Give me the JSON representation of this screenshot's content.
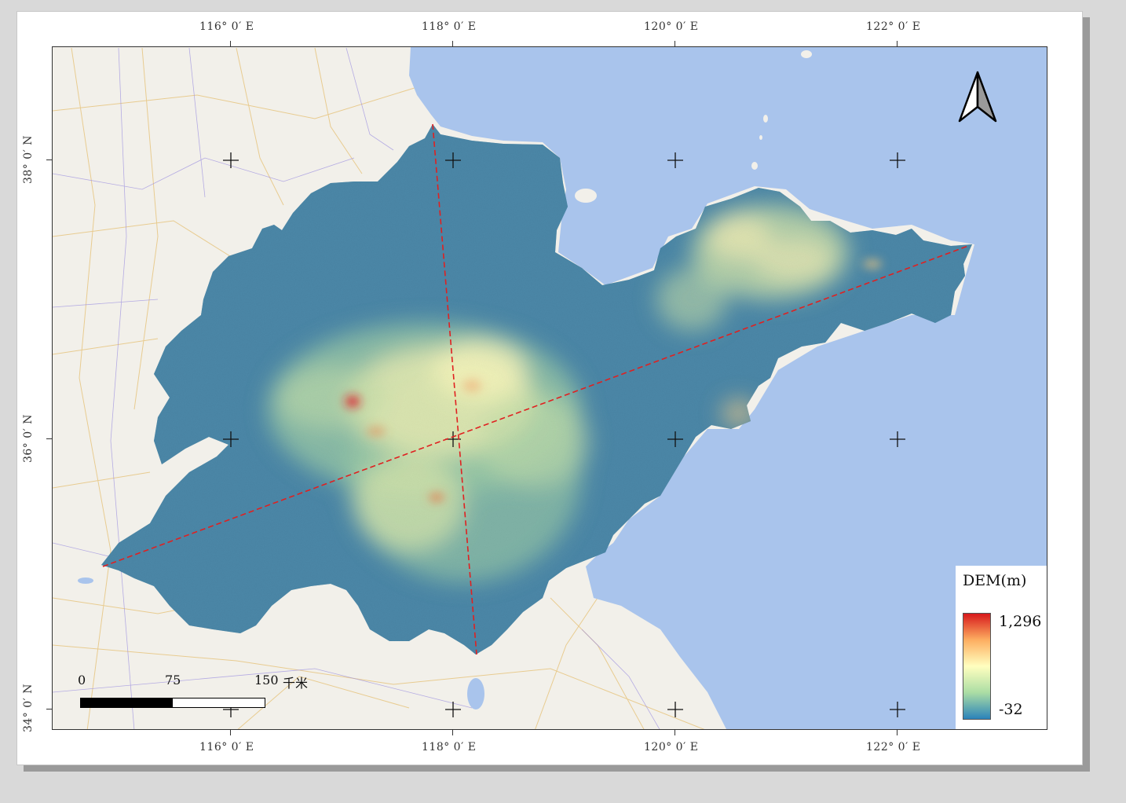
{
  "map": {
    "lon_labels": [
      "116° 0′ E",
      "118° 0′ E",
      "120° 0′ E",
      "122° 0′ E"
    ],
    "lat_labels": [
      "38° 0′ N",
      "36° 0′ N",
      "34° 0′ N"
    ],
    "graticule_marks": "+",
    "north_arrow_icon": "north-arrow-icon"
  },
  "scale_bar": {
    "labels": [
      "0",
      "75",
      "150"
    ],
    "unit": "千米"
  },
  "legend": {
    "title": "DEM(m)",
    "max_label": "1,296",
    "min_label": "-32",
    "colors": [
      "#d7191c",
      "#fdae61",
      "#ffffbf",
      "#abdda4",
      "#2b83ba"
    ]
  },
  "colors": {
    "sea": "#a9c4ec",
    "land_base": "#f2f0ea",
    "dem_low": "#2f6f95",
    "profile_line": "#e02020"
  }
}
